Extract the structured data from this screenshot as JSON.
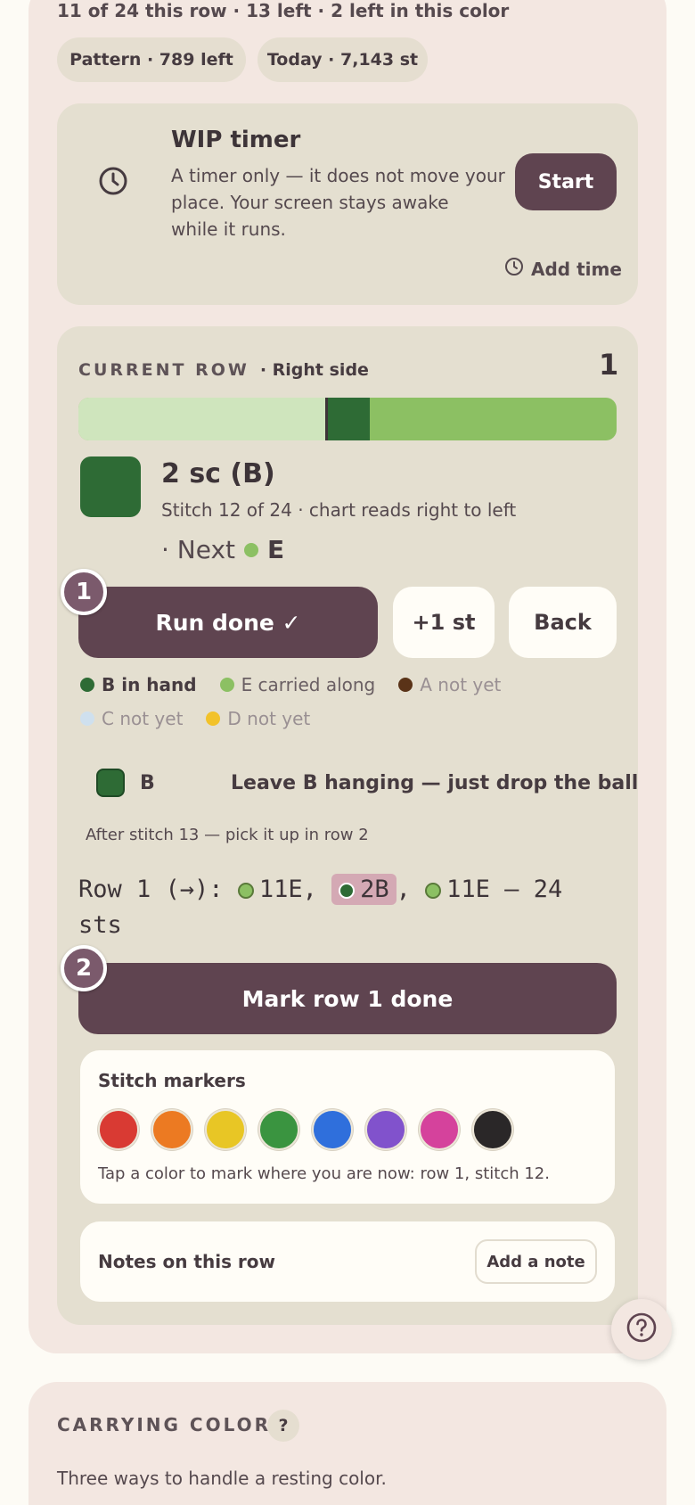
{
  "status": {
    "line": "11 of 24 this row · 13 left · 2 left in this color",
    "chips": [
      "Pattern · 789 left",
      "Today · 7,143 st"
    ]
  },
  "timer": {
    "icon": "clock-icon",
    "title": "WIP timer",
    "description_lines": [
      "A timer only — it does not move your",
      "place. Your screen stays awake",
      "while it runs."
    ],
    "start_label": "Start",
    "add_time_label": "Add time"
  },
  "row": {
    "heading": "CURRENT ROW",
    "side": "· Right side",
    "number": "1",
    "progress": {
      "done_fraction": 0.458,
      "current_start_fraction": 0.458,
      "current_end_fraction": 0.542
    },
    "stitch_title": "2 sc (B)",
    "stitch_subtitle": "Stitch 12 of 24 · chart reads right to left",
    "next_prefix": "· Next",
    "next_color": "E",
    "run_done_label": "Run done ✓",
    "plus_one_label": "+1 st",
    "back_label": "Back",
    "badge_1": "1",
    "badge_2": "2",
    "legend": [
      {
        "label": "B in hand",
        "color": "#2e6b35",
        "active": true
      },
      {
        "label": "E carried along",
        "color": "#8cc063",
        "active": false
      },
      {
        "label": "A not yet",
        "color": "#5a3318",
        "active": false
      },
      {
        "label": "C not yet",
        "color": "#cfe0ee",
        "active": false
      },
      {
        "label": "D not yet",
        "color": "#f2c22a",
        "active": false
      }
    ],
    "leave_color": "B",
    "leave_text": "Leave B hanging — just drop the ball",
    "after_text": "After stitch 13 — pick it up in row 2",
    "pattern_prefix": "Row 1 (→): ",
    "pattern_seg1": "11E,",
    "pattern_seg2": "2B",
    "pattern_comma": ",",
    "pattern_seg3": "11E — 24",
    "pattern_suffix": "sts",
    "mark_done_label": "Mark row 1 done"
  },
  "markers": {
    "title": "Stitch markers",
    "colors": [
      "#d93a33",
      "#ec7a22",
      "#e8c625",
      "#3a9440",
      "#2f6fdc",
      "#8152cc",
      "#d5429c",
      "#2a2728"
    ],
    "hint": "Tap a color to mark where you are now: row 1, stitch 12."
  },
  "notes": {
    "label": "Notes on this row",
    "add_label": "Add a note"
  },
  "help": {
    "icon": "help-icon"
  },
  "carrying": {
    "heading": "CARRYING COLORS",
    "help_glyph": "?",
    "intro": "Three ways to handle a resting color."
  },
  "colors": {
    "accent": "#5f4450",
    "color_B": "#2e6b35",
    "color_E": "#8cc063",
    "progress_remaining": "#8cc063",
    "progress_done": "#cfe5bd",
    "pattern_highlight": "#d4a9b4"
  }
}
